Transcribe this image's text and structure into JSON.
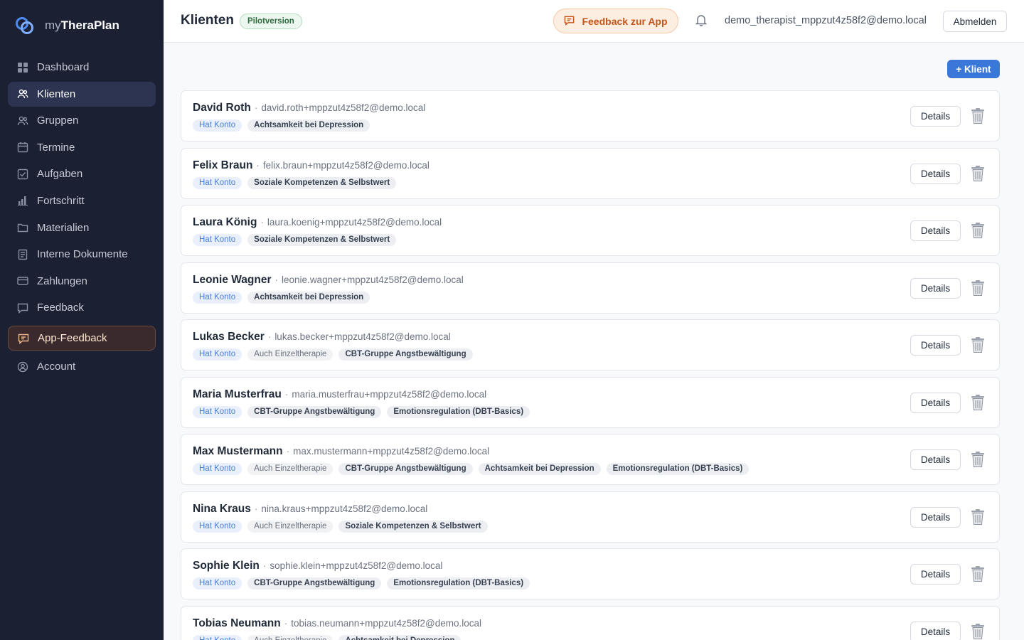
{
  "brand": {
    "prefix": "my",
    "name": "TheraPlan",
    "logo_icon": "rings-logo-icon"
  },
  "sidebar": {
    "items": [
      {
        "label": "Dashboard",
        "icon": "grid-icon",
        "active": false
      },
      {
        "label": "Klienten",
        "icon": "users-icon",
        "active": true
      },
      {
        "label": "Gruppen",
        "icon": "group-icon",
        "active": false
      },
      {
        "label": "Termine",
        "icon": "calendar-icon",
        "active": false
      },
      {
        "label": "Aufgaben",
        "icon": "checkbox-icon",
        "active": false
      },
      {
        "label": "Fortschritt",
        "icon": "bar-chart-icon",
        "active": false
      },
      {
        "label": "Materialien",
        "icon": "folder-icon",
        "active": false
      },
      {
        "label": "Interne Dokumente",
        "icon": "document-icon",
        "active": false
      },
      {
        "label": "Zahlungen",
        "icon": "credit-card-icon",
        "active": false
      },
      {
        "label": "Feedback",
        "icon": "chat-icon",
        "active": false
      }
    ],
    "app_feedback": {
      "label": "App-Feedback",
      "icon": "chat-lines-icon"
    },
    "account": {
      "label": "Account",
      "icon": "user-circle-icon"
    }
  },
  "header": {
    "title": "Klienten",
    "badge": "Pilotversion",
    "feedback_button": "Feedback zur App",
    "user_email": "demo_therapist_mppzut4z58f2@demo.local",
    "logout": "Abmelden"
  },
  "main": {
    "add_button": "+ Klient",
    "details_label": "Details",
    "separator": "·"
  },
  "clients": [
    {
      "name": "David Roth",
      "email": "david.roth+mppzut4z58f2@demo.local",
      "tags": [
        {
          "text": "Hat Konto",
          "kind": "account"
        },
        {
          "text": "Achtsamkeit bei Depression",
          "kind": "group"
        }
      ]
    },
    {
      "name": "Felix Braun",
      "email": "felix.braun+mppzut4z58f2@demo.local",
      "tags": [
        {
          "text": "Hat Konto",
          "kind": "account"
        },
        {
          "text": "Soziale Kompetenzen & Selbstwert",
          "kind": "group"
        }
      ]
    },
    {
      "name": "Laura König",
      "email": "laura.koenig+mppzut4z58f2@demo.local",
      "tags": [
        {
          "text": "Hat Konto",
          "kind": "account"
        },
        {
          "text": "Soziale Kompetenzen & Selbstwert",
          "kind": "group"
        }
      ]
    },
    {
      "name": "Leonie Wagner",
      "email": "leonie.wagner+mppzut4z58f2@demo.local",
      "tags": [
        {
          "text": "Hat Konto",
          "kind": "account"
        },
        {
          "text": "Achtsamkeit bei Depression",
          "kind": "group"
        }
      ]
    },
    {
      "name": "Lukas Becker",
      "email": "lukas.becker+mppzut4z58f2@demo.local",
      "tags": [
        {
          "text": "Hat Konto",
          "kind": "account"
        },
        {
          "text": "Auch Einzeltherapie",
          "kind": "single"
        },
        {
          "text": "CBT-Gruppe Angstbewältigung",
          "kind": "group"
        }
      ]
    },
    {
      "name": "Maria Musterfrau",
      "email": "maria.musterfrau+mppzut4z58f2@demo.local",
      "tags": [
        {
          "text": "Hat Konto",
          "kind": "account"
        },
        {
          "text": "CBT-Gruppe Angstbewältigung",
          "kind": "group"
        },
        {
          "text": "Emotionsregulation (DBT-Basics)",
          "kind": "group"
        }
      ]
    },
    {
      "name": "Max Mustermann",
      "email": "max.mustermann+mppzut4z58f2@demo.local",
      "tags": [
        {
          "text": "Hat Konto",
          "kind": "account"
        },
        {
          "text": "Auch Einzeltherapie",
          "kind": "single"
        },
        {
          "text": "CBT-Gruppe Angstbewältigung",
          "kind": "group"
        },
        {
          "text": "Achtsamkeit bei Depression",
          "kind": "group"
        },
        {
          "text": "Emotionsregulation (DBT-Basics)",
          "kind": "group"
        }
      ]
    },
    {
      "name": "Nina Kraus",
      "email": "nina.kraus+mppzut4z58f2@demo.local",
      "tags": [
        {
          "text": "Hat Konto",
          "kind": "account"
        },
        {
          "text": "Auch Einzeltherapie",
          "kind": "single"
        },
        {
          "text": "Soziale Kompetenzen & Selbstwert",
          "kind": "group"
        }
      ]
    },
    {
      "name": "Sophie Klein",
      "email": "sophie.klein+mppzut4z58f2@demo.local",
      "tags": [
        {
          "text": "Hat Konto",
          "kind": "account"
        },
        {
          "text": "CBT-Gruppe Angstbewältigung",
          "kind": "group"
        },
        {
          "text": "Emotionsregulation (DBT-Basics)",
          "kind": "group"
        }
      ]
    },
    {
      "name": "Tobias Neumann",
      "email": "tobias.neumann+mppzut4z58f2@demo.local",
      "tags": [
        {
          "text": "Hat Konto",
          "kind": "account"
        },
        {
          "text": "Auch Einzeltherapie",
          "kind": "single"
        },
        {
          "text": "Achtsamkeit bei Depression",
          "kind": "group"
        }
      ]
    }
  ],
  "icons": {
    "notification": "bell-icon",
    "delete": "trash-icon",
    "feedback": "chat-lines-icon"
  },
  "colors": {
    "sidebar_bg": "#1c2033",
    "accent": "#3b76d9",
    "feedback_accent": "#c4561c"
  }
}
